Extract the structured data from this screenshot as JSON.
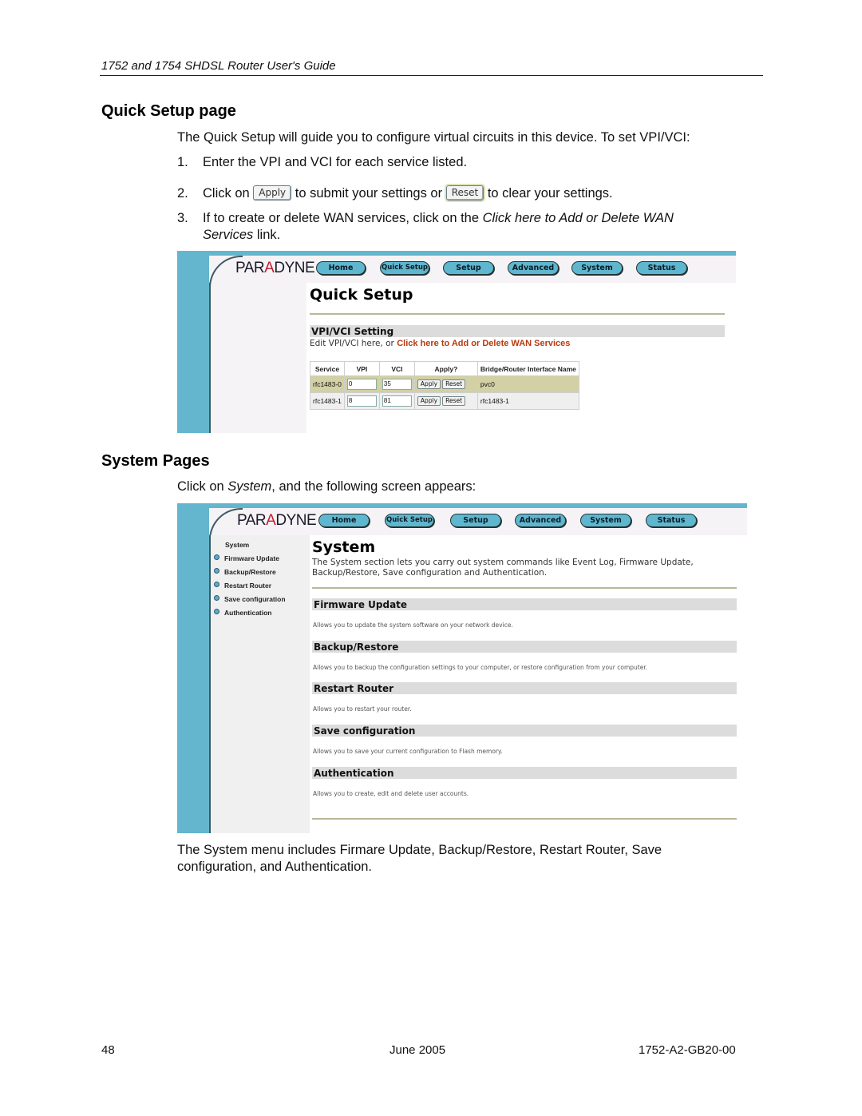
{
  "running_header": "1752 and 1754 SHDSL Router User's Guide",
  "quick_setup_section": {
    "heading": "Quick Setup page",
    "intro": "The Quick Setup will guide you to configure virtual circuits in this device. To set VPI/VCI:",
    "steps": [
      {
        "num": "1.",
        "text": "Enter the VPI and VCI for each service listed."
      },
      {
        "num": "2.",
        "pre": "Click on",
        "apply_btn": "Apply",
        "mid": "to submit your settings or",
        "reset_btn": "Reset",
        "post": "to clear your settings."
      },
      {
        "num": "3.",
        "pre": "If to create or delete WAN services, click on the",
        "link_italic": "Click here to Add or Delete WAN",
        "line2_italic": "Services",
        "line2_post": " link."
      }
    ]
  },
  "screenshot_quick_setup": {
    "logo": {
      "pre": "PAR",
      "accent": "A",
      "post": "DYNE"
    },
    "nav": [
      "Home",
      "Quick Setup",
      "Setup",
      "Advanced",
      "System",
      "Status"
    ],
    "title": "Quick Setup",
    "section": "VPI/VCI Setting",
    "edit_text": "Edit VPI/VCI here, or ",
    "edit_link": "Click here to Add or Delete WAN Services",
    "table": {
      "headers": [
        "Service",
        "VPI",
        "VCI",
        "Apply?",
        "Bridge/Router Interface Name"
      ],
      "rows": [
        {
          "service": "rfc1483-0",
          "vpi": "0",
          "vci": "35",
          "apply": "Apply",
          "reset": "Reset",
          "iface": "pvc0"
        },
        {
          "service": "rfc1483-1",
          "vpi": "8",
          "vci": "81",
          "apply": "Apply",
          "reset": "Reset",
          "iface": "rfc1483-1"
        }
      ]
    }
  },
  "system_section": {
    "heading": "System Pages",
    "intro_pre": "Click on ",
    "intro_italic": "System",
    "intro_post": ", and the following screen appears:",
    "summary_line1": "The System menu includes Firmare Update, Backup/Restore, Restart Router, Save",
    "summary_line2": "configuration, and Authentication."
  },
  "screenshot_system": {
    "logo": {
      "pre": "PAR",
      "accent": "A",
      "post": "DYNE"
    },
    "nav": [
      "Home",
      "Quick Setup",
      "Setup",
      "Advanced",
      "System",
      "Status"
    ],
    "side_menu": {
      "title": "System",
      "items": [
        "Firmware Update",
        "Backup/Restore",
        "Restart Router",
        "Save configuration",
        "Authentication"
      ]
    },
    "title": "System",
    "description_line1": "The System section lets you carry out system commands like Event Log, Firmware Update,",
    "description_line2": "Backup/Restore, Save configuration and Authentication.",
    "sections": [
      {
        "heading": "Firmware Update",
        "text": "Allows you to update the system software on your network device."
      },
      {
        "heading": "Backup/Restore",
        "text": "Allows you to backup the configuration settings to your computer, or restore configuration from your computer."
      },
      {
        "heading": "Restart Router",
        "text": "Allows you to restart your router."
      },
      {
        "heading": "Save configuration",
        "text": "Allows you to save your current configuration to Flash memory."
      },
      {
        "heading": "Authentication",
        "text": "Allows you to create, edit and delete user accounts."
      }
    ]
  },
  "footer": {
    "page_number": "48",
    "date": "June 2005",
    "doc_id": "1752-A2-GB20-00"
  },
  "colors": {
    "frame_blue": "#63b6cd",
    "nav_button": "#5fb6cf",
    "link_red": "#b83a10",
    "row_highlight": "#d2d0a4"
  }
}
